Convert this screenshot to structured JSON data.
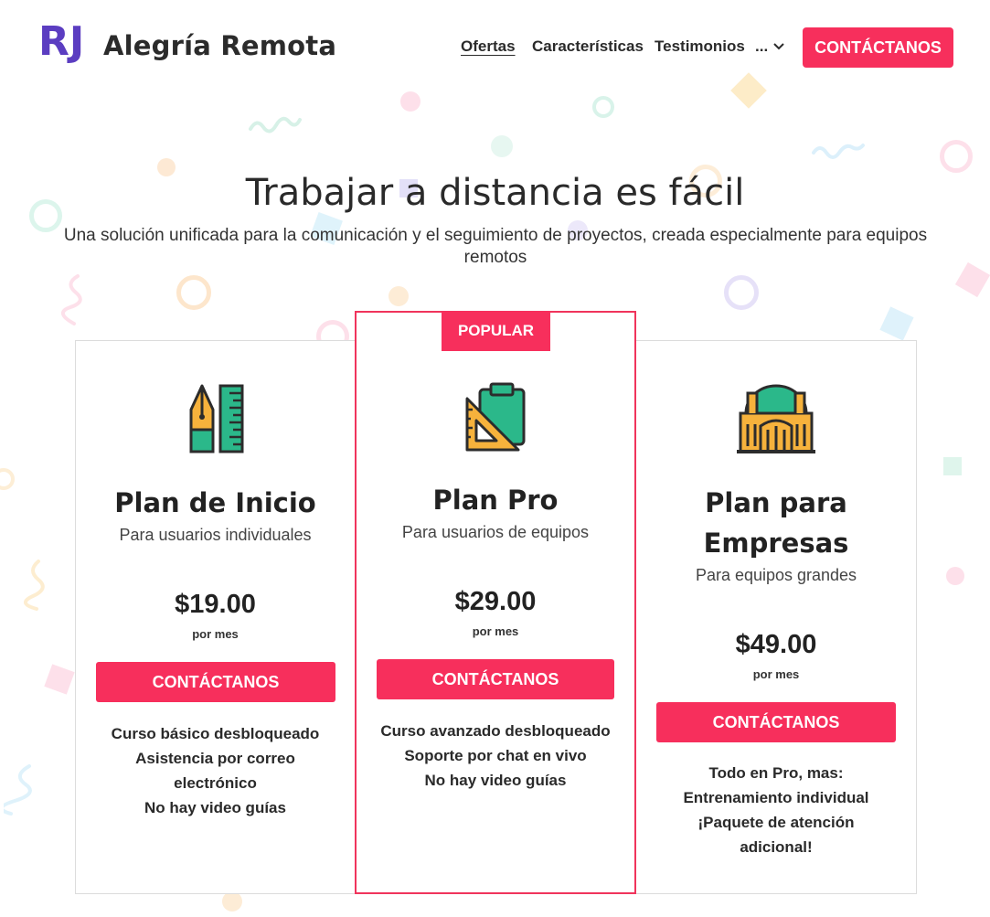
{
  "header": {
    "logo_mark": "RJ",
    "brand": "Alegría Remota",
    "nav": [
      "Ofertas",
      "Características",
      "Testimonios"
    ],
    "more_label": "...",
    "cta": "CONTÁCTANOS"
  },
  "hero": {
    "title": "Trabajar a distancia es fácil",
    "subtitle": "Una solución unificada para la comunicación y el seguimiento de proyectos, creada especialmente para equipos remotos"
  },
  "colors": {
    "accent": "#f72f5c",
    "logo": "#5b3dc1",
    "icon_yellow": "#f6b23c",
    "icon_green": "#2bb88a"
  },
  "plans": [
    {
      "icon": "pen-ruler-icon",
      "title": "Plan de Inicio",
      "subtitle": "Para usuarios individuales",
      "price": "$19.00",
      "period": "por mes",
      "cta": "CONTÁCTANOS",
      "features": [
        "Curso básico desbloqueado",
        "Asistencia por correo",
        "electrónico",
        "No hay video guías"
      ]
    },
    {
      "badge": "POPULAR",
      "icon": "clipboard-set-square-icon",
      "title": "Plan Pro",
      "subtitle": "Para usuarios de equipos",
      "price": "$29.00",
      "period": "por mes",
      "cta": "CONTÁCTANOS",
      "features": [
        "Curso avanzado desbloqueado",
        "Soporte por chat en vivo",
        "No hay video guías"
      ]
    },
    {
      "icon": "building-dome-icon",
      "title_lines": [
        "Plan para",
        "Empresas"
      ],
      "subtitle": "Para equipos grandes",
      "price": "$49.00",
      "period": "por mes",
      "cta": "CONTÁCTANOS",
      "features": [
        "Todo en Pro, mas:",
        "Entrenamiento individual",
        "¡Paquete de atención",
        "adicional!"
      ]
    }
  ]
}
